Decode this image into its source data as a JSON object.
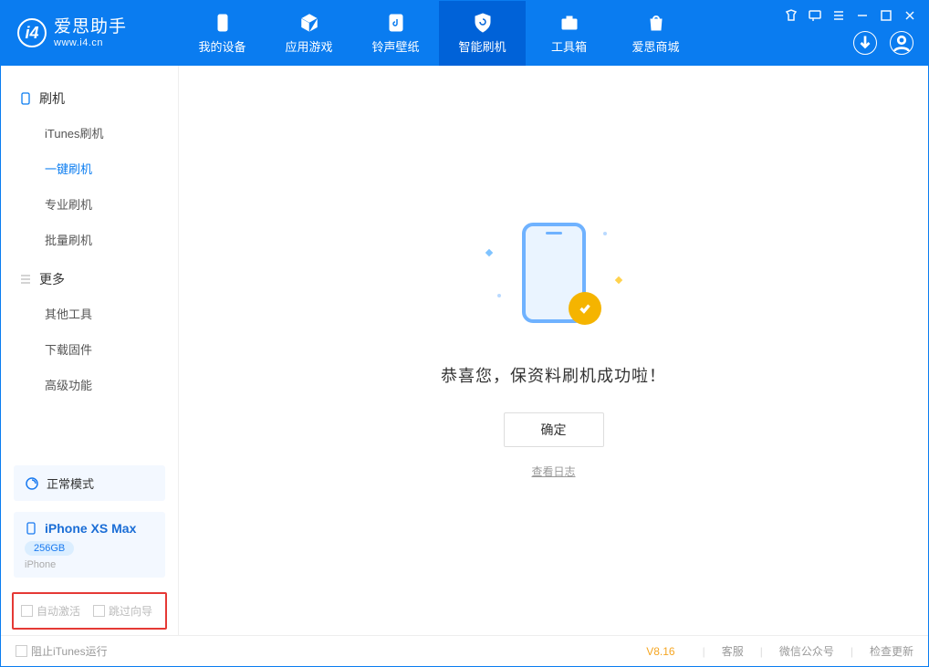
{
  "app": {
    "title": "爱思助手",
    "subtitle": "www.i4.cn"
  },
  "tabs": {
    "device": "我的设备",
    "apps": "应用游戏",
    "rings": "铃声壁纸",
    "flash": "智能刷机",
    "toolbox": "工具箱",
    "store": "爱思商城"
  },
  "sidebar": {
    "group_flash": "刷机",
    "items": {
      "itunes": "iTunes刷机",
      "onekey": "一键刷机",
      "pro": "专业刷机",
      "batch": "批量刷机"
    },
    "group_more": "更多",
    "more": {
      "other": "其他工具",
      "firmware": "下载固件",
      "advanced": "高级功能"
    }
  },
  "mode": {
    "label": "正常模式"
  },
  "device": {
    "name": "iPhone XS Max",
    "storage": "256GB",
    "type": "iPhone"
  },
  "footer_checks": {
    "auto_activate": "自动激活",
    "skip_guide": "跳过向导"
  },
  "main": {
    "success": "恭喜您，保资料刷机成功啦！",
    "ok": "确定",
    "view_log": "查看日志"
  },
  "bottom": {
    "block_itunes": "阻止iTunes运行",
    "version": "V8.16",
    "support": "客服",
    "wechat": "微信公众号",
    "update": "检查更新"
  }
}
